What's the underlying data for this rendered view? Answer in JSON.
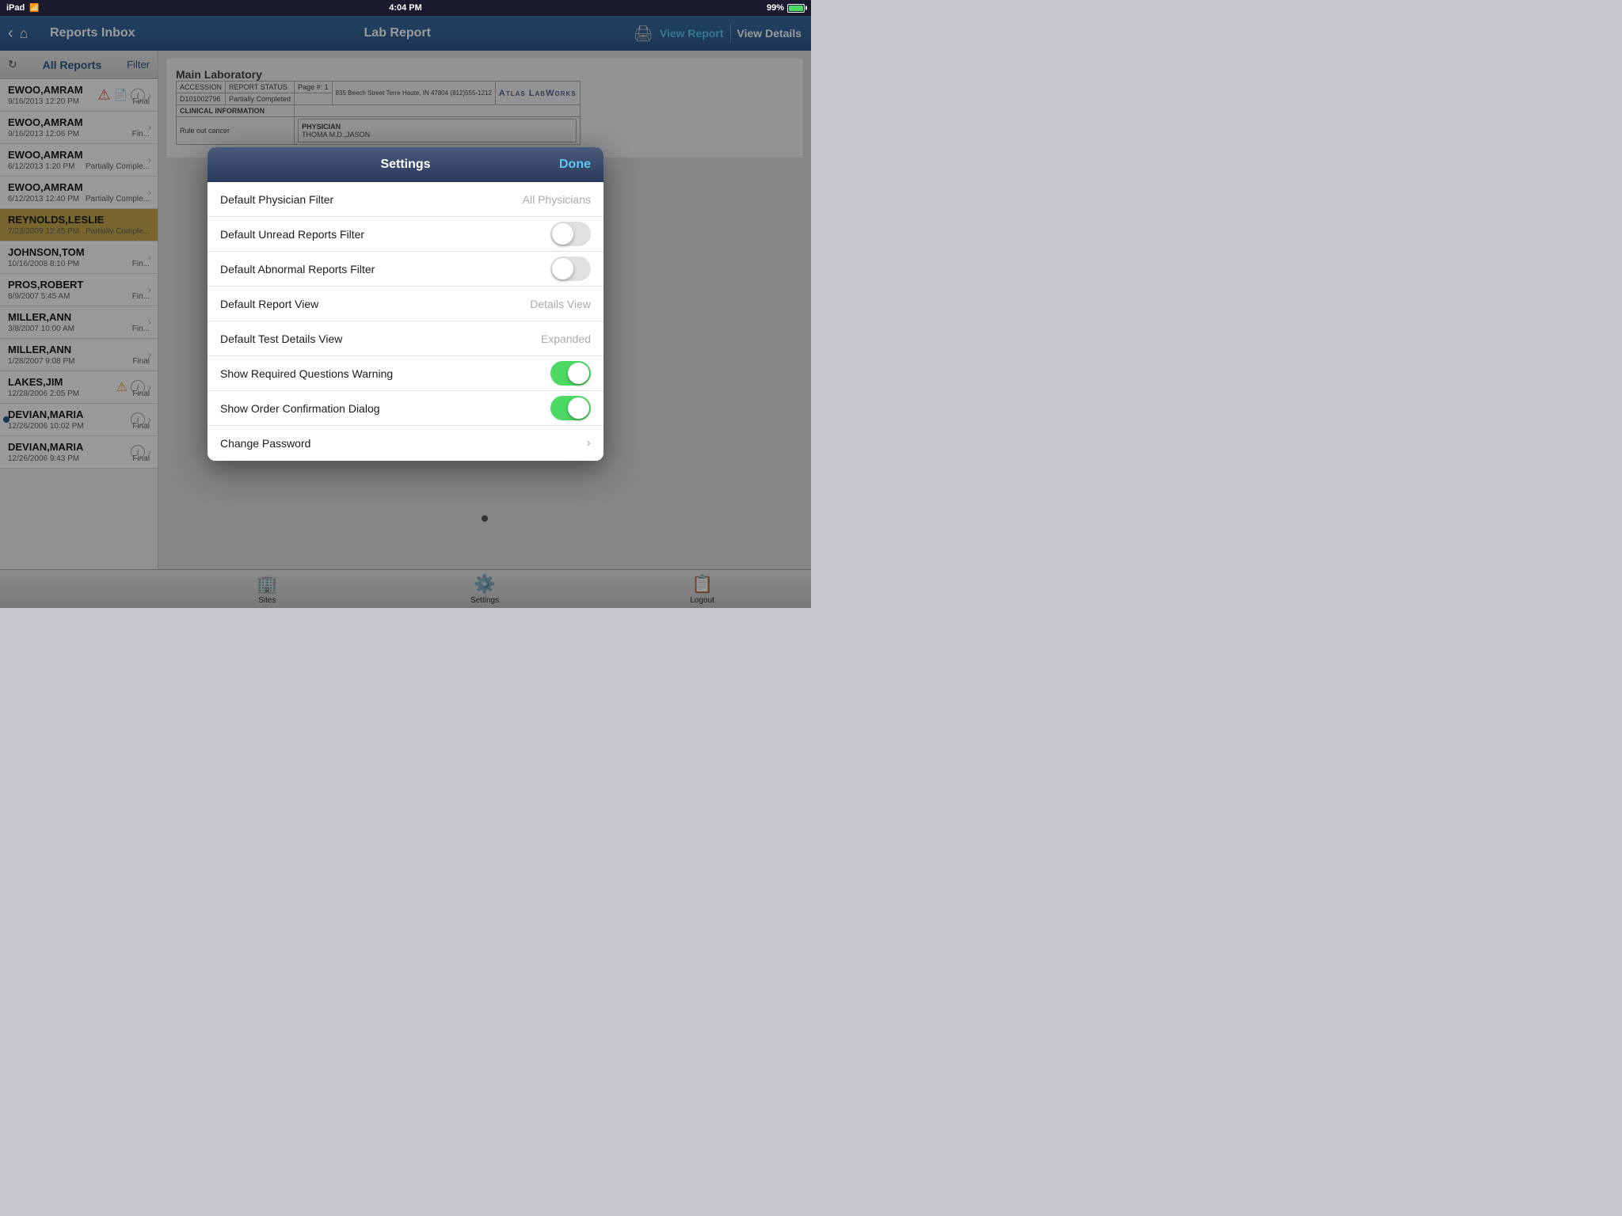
{
  "statusBar": {
    "leftLabel": "iPad",
    "wifiLabel": "WiFi",
    "timeLabel": "4:04 PM",
    "batteryPercent": "99%"
  },
  "navBar": {
    "leftTitle": "Reports Inbox",
    "rightTitle": "Lab Report",
    "viewReportLabel": "View Report",
    "viewDetailsLabel": "View Details"
  },
  "sidebar": {
    "title": "All Reports",
    "filterLabel": "Filter",
    "items": [
      {
        "name": "EWOO,AMRAM",
        "date": "9/16/2013 12:20 PM",
        "status": "Final",
        "hasAlert": true,
        "alertType": "red",
        "hasInfo": true,
        "hasDoc": true
      },
      {
        "name": "EWOO,AMRAM",
        "date": "9/16/2013 12:06 PM",
        "status": "Fin...",
        "hasAlert": false
      },
      {
        "name": "EWOO,AMRAM",
        "date": "6/12/2013 1:20 PM",
        "status": "Partially Comple...",
        "hasAlert": false
      },
      {
        "name": "EWOO,AMRAM",
        "date": "6/12/2013 12:40 PM",
        "status": "Partially Comple...",
        "hasAlert": false
      },
      {
        "name": "REYNOLDS,LESLIE",
        "date": "7/23/2009 12:45 PM",
        "status": "Partially Comple...",
        "hasAlert": false,
        "active": true
      },
      {
        "name": "JOHNSON,TOM",
        "date": "10/16/2008 8:10 PM",
        "status": "Fin...",
        "hasAlert": false
      },
      {
        "name": "PROS,ROBERT",
        "date": "8/9/2007 5:45 AM",
        "status": "Fin...",
        "hasAlert": false
      },
      {
        "name": "MILLER,ANN",
        "date": "3/8/2007 10:00 AM",
        "status": "Fin...",
        "hasAlert": false
      },
      {
        "name": "MILLER,ANN",
        "date": "1/28/2007 9:08 PM",
        "status": "Final",
        "hasAlert": false
      },
      {
        "name": "LAKES,JIM",
        "date": "12/28/2006 2:05 PM",
        "status": "Final",
        "hasAlert": true,
        "alertType": "yellow",
        "hasInfo": true
      },
      {
        "name": "DEVIAN,MARIA",
        "date": "12/26/2006 10:02 PM",
        "status": "Final",
        "hasAlert": false,
        "hasInfo": true,
        "unreadDot": true
      },
      {
        "name": "DEVIAN,MARIA",
        "date": "12/26/2006 9:43 PM",
        "status": "Final",
        "hasAlert": false,
        "hasInfo": true
      }
    ]
  },
  "report": {
    "labName": "Main Laboratory",
    "accessionLabel": "ACCESSION",
    "accessionValue": "D101002796",
    "reportStatusLabel": "REPORT STATUS",
    "reportStatusValue": "Partially Completed",
    "pageLabel": "Page #: 1",
    "address": "835 Beech Street\nTerre Haute, IN 47804\n(812)555-1212",
    "atlasLogo": "Atlas LabWorks",
    "clinicalInfoLabel": "CLINICAL INFORMATION",
    "clinicalInfoValue": "Rule out cancer",
    "physicianLabel": "PHYSICIAN",
    "physicianValue": "THOMA M.D.,JASON"
  },
  "settings": {
    "title": "Settings",
    "doneLabel": "Done",
    "rows": [
      {
        "label": "Default Physician Filter",
        "valueType": "text",
        "value": "All Physicians"
      },
      {
        "label": "Default Unread Reports Filter",
        "valueType": "toggle",
        "on": false
      },
      {
        "label": "Default Abnormal Reports Filter",
        "valueType": "toggle",
        "on": false
      },
      {
        "label": "Default Report View",
        "valueType": "text",
        "value": "Details View"
      },
      {
        "label": "Default Test Details View",
        "valueType": "text",
        "value": "Expanded"
      },
      {
        "label": "Show Required Questions Warning",
        "valueType": "toggle",
        "on": true
      },
      {
        "label": "Show Order Confirmation Dialog",
        "valueType": "toggle",
        "on": true
      },
      {
        "label": "Change Password",
        "valueType": "chevron",
        "value": ""
      }
    ]
  },
  "tabBar": {
    "items": [
      {
        "icon": "🏢",
        "label": "Sites"
      },
      {
        "icon": "⚙️",
        "label": "Settings"
      },
      {
        "icon": "📋",
        "label": "Logout"
      }
    ]
  }
}
